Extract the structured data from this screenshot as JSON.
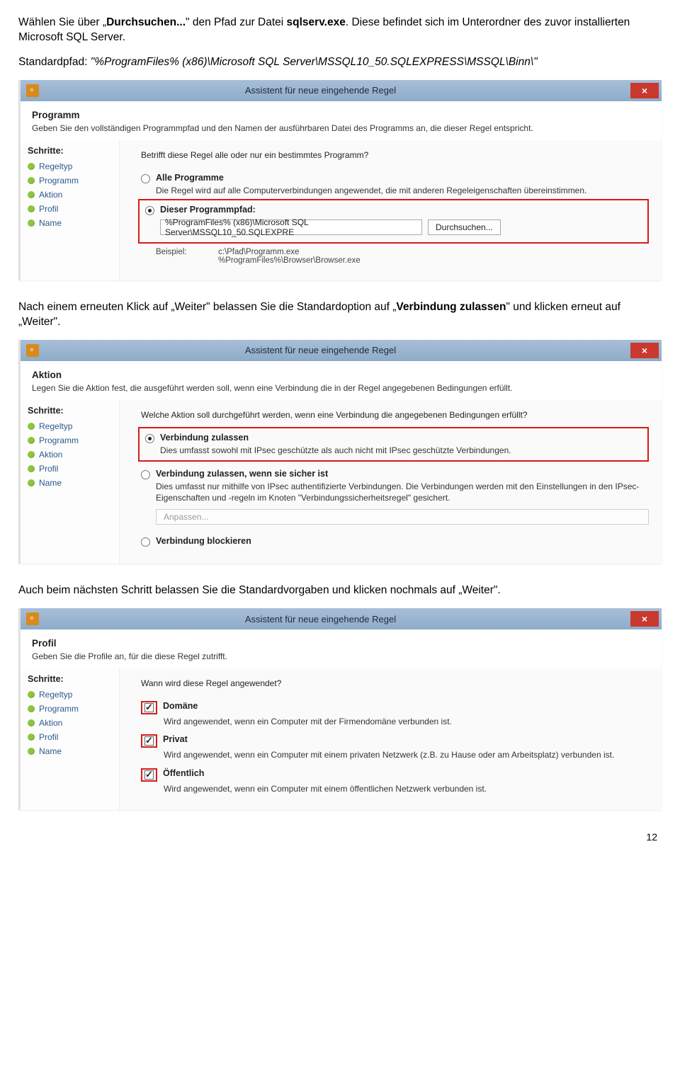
{
  "doc": {
    "p1": "Wählen Sie über „Durchsuchen...\" den Pfad zur Datei sqlserv.exe. Diese befindet sich im Unterordner des zuvor installierten Microsoft SQL Server.",
    "p1_bold1": "Durchsuchen...",
    "p1_bold2": "sqlserv.exe",
    "p2_prefix": "Standardpfad: ",
    "p2_italic": "\"%ProgramFiles% (x86)\\Microsoft SQL Server\\MSSQL10_50.SQLEXPRESS\\MSSQL\\Binn\\\"",
    "p3a": "Nach einem erneuten Klick auf „Weiter\" belassen Sie die Standardoption auf „",
    "p3b": "Verbindung zulassen",
    "p3c": "\" und klicken erneut auf „Weiter\".",
    "p4": "Auch beim nächsten Schritt belassen Sie die Standardvorgaben und klicken nochmals auf „Weiter\".",
    "pagenum": "12"
  },
  "common": {
    "win_title": "Assistent für neue eingehende Regel",
    "close": "×",
    "steps_title": "Schritte:",
    "steps": [
      "Regeltyp",
      "Programm",
      "Aktion",
      "Profil",
      "Name"
    ],
    "browse": "Durchsuchen...",
    "anpassen": "Anpassen..."
  },
  "win1": {
    "h": "Programm",
    "sub": "Geben Sie den vollständigen Programmpfad und den Namen der ausführbaren Datei des Programms an, die dieser Regel entspricht.",
    "q": "Betrifft diese Regel alle oder nur ein bestimmtes Programm?",
    "opt1": "Alle Programme",
    "opt1_sub": "Die Regel wird auf alle Computerverbindungen angewendet, die mit anderen Regeleigenschaften übereinstimmen.",
    "opt2": "Dieser Programmpfad:",
    "path_value": "%ProgramFiles% (x86)\\Microsoft SQL Server\\MSSQL10_50.SQLEXPRE",
    "ex_label": "Beispiel:",
    "ex1": "c:\\Pfad\\Programm.exe",
    "ex2": "%ProgramFiles%\\Browser\\Browser.exe"
  },
  "win2": {
    "h": "Aktion",
    "sub": "Legen Sie die Aktion fest, die ausgeführt werden soll, wenn eine Verbindung die in der Regel angegebenen Bedingungen erfüllt.",
    "q": "Welche Aktion soll durchgeführt werden, wenn eine Verbindung die angegebenen Bedingungen erfüllt?",
    "opt1": "Verbindung zulassen",
    "opt1_sub": "Dies umfasst sowohl mit IPsec geschützte als auch nicht mit IPsec geschützte Verbindungen.",
    "opt2": "Verbindung zulassen, wenn sie sicher ist",
    "opt2_sub": "Dies umfasst nur mithilfe von IPsec authentifizierte Verbindungen. Die Verbindungen werden mit den Einstellungen in den IPsec-Eigenschaften und -regeln im Knoten \"Verbindungssicherheitsregel\" gesichert.",
    "opt3": "Verbindung blockieren"
  },
  "win3": {
    "h": "Profil",
    "sub": "Geben Sie die Profile an, für die diese Regel zutrifft.",
    "q": "Wann wird diese Regel angewendet?",
    "c1": "Domäne",
    "c1_sub": "Wird angewendet, wenn ein Computer mit der Firmendomäne verbunden ist.",
    "c2": "Privat",
    "c2_sub": "Wird angewendet, wenn ein Computer mit einem privaten Netzwerk (z.B. zu Hause oder am Arbeitsplatz) verbunden ist.",
    "c3": "Öffentlich",
    "c3_sub": "Wird angewendet, wenn ein Computer mit einem öffentlichen Netzwerk verbunden ist."
  }
}
